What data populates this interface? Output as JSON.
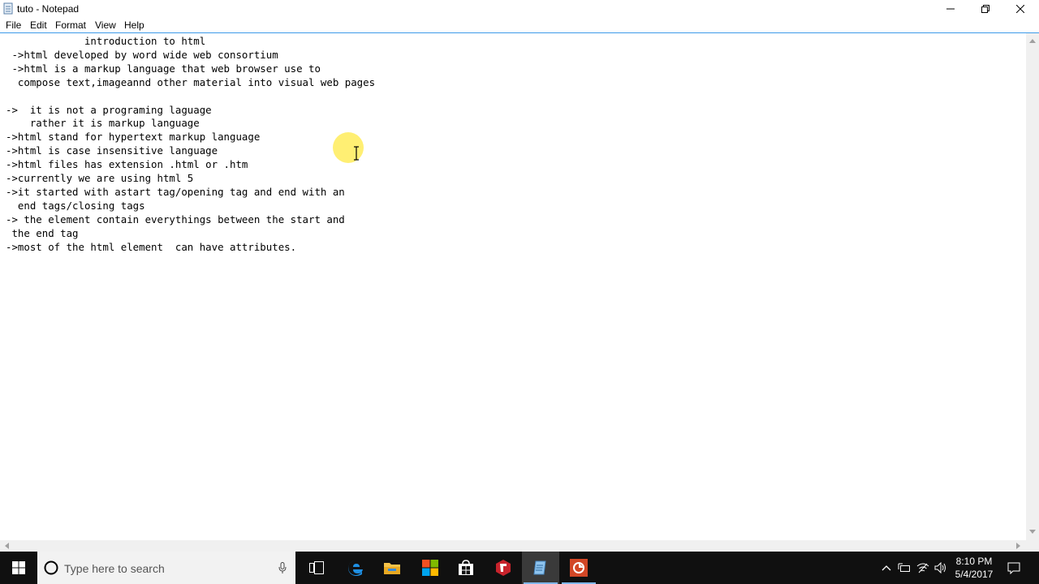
{
  "window": {
    "title": "tuto - Notepad"
  },
  "menu": {
    "items": [
      "File",
      "Edit",
      "Format",
      "View",
      "Help"
    ]
  },
  "editor": {
    "content": "             introduction to html\n ->html developed by word wide web consortium\n ->html is a markup language that web browser use to\n  compose text,imageannd other material into visual web pages\n\n->  it is not a programing laguage\n    rather it is markup language\n->html stand for hypertext markup language\n->html is case insensitive language\n->html files has extension .html or .htm\n->currently we are using html 5\n->it started with astart tag/opening tag and end with an\n  end tags/closing tags\n-> the element contain everythings between the start and\n the end tag\n->most of the html element  can have attributes."
  },
  "taskbar": {
    "search_placeholder": "Type here to search",
    "clock_time": "8:10 PM",
    "clock_date": "5/4/2017",
    "icons": [
      "windows-start-icon",
      "cortana-circle-icon",
      "microphone-icon",
      "task-view-icon",
      "edge-icon",
      "file-explorer-icon",
      "office-icon",
      "store-icon",
      "chrome-like-icon",
      "notepad-icon",
      "powerpoint-icon"
    ],
    "tray_icons": [
      "chevron-up-icon",
      "battery-icon",
      "wifi-icon",
      "volume-icon",
      "action-center-icon"
    ]
  },
  "colors": {
    "menu_border": "#3d9be9",
    "taskbar_bg": "#101010",
    "cursor_highlight": "#ffec5a"
  }
}
